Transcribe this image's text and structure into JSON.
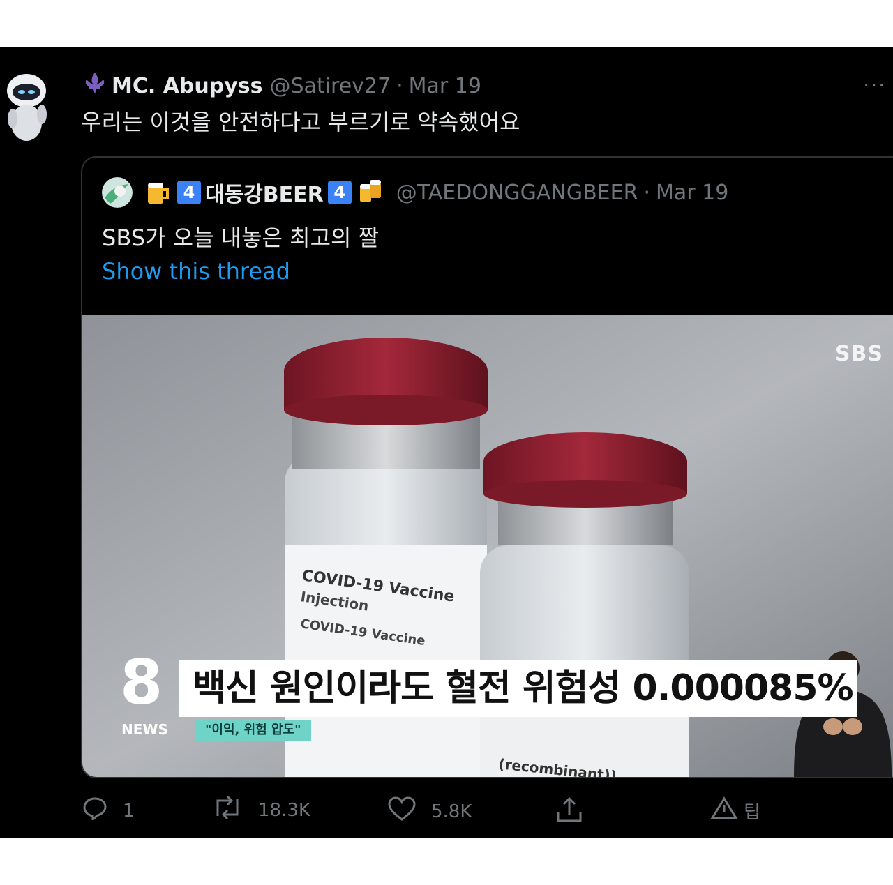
{
  "tweet": {
    "author_name": "MC. Abupyss",
    "handle": "@Satirev27",
    "separator": "·",
    "date": "Mar 19",
    "more": "···",
    "text": "우리는 이것을 안전하다고 부르기로 약속했어요"
  },
  "quote": {
    "badge_left": "4",
    "author_name": "대동강BEER",
    "badge_right": "4",
    "handle": "@TAEDONGGANGBEER",
    "separator": "·",
    "date": "Mar 19",
    "text": "SBS가 오늘 내놓은 최고의 짤",
    "show_thread": "Show this thread",
    "media": {
      "channel_logo": "SBS",
      "news_number": "8",
      "news_label": "NEWS",
      "caption": "백신 원인이라도 혈전 위험성 0.000085%",
      "subcaption": "\"이익, 위험 압도\"",
      "vial_label_1": "COVID-19 Vaccine",
      "vial_label_2": "Injection",
      "vial_label_3": "COVID-19 Vaccine",
      "vial_label_4": "(recombinant))"
    }
  },
  "actions": {
    "reply_count": "1",
    "retweet_count": "18.3K",
    "like_count": "5.8K",
    "tip_label": "팁"
  },
  "colors": {
    "background": "#000000",
    "text": "#e7e9ea",
    "muted": "#71767b",
    "link": "#1d9bf0",
    "cap_red": "#8a1f2e"
  }
}
